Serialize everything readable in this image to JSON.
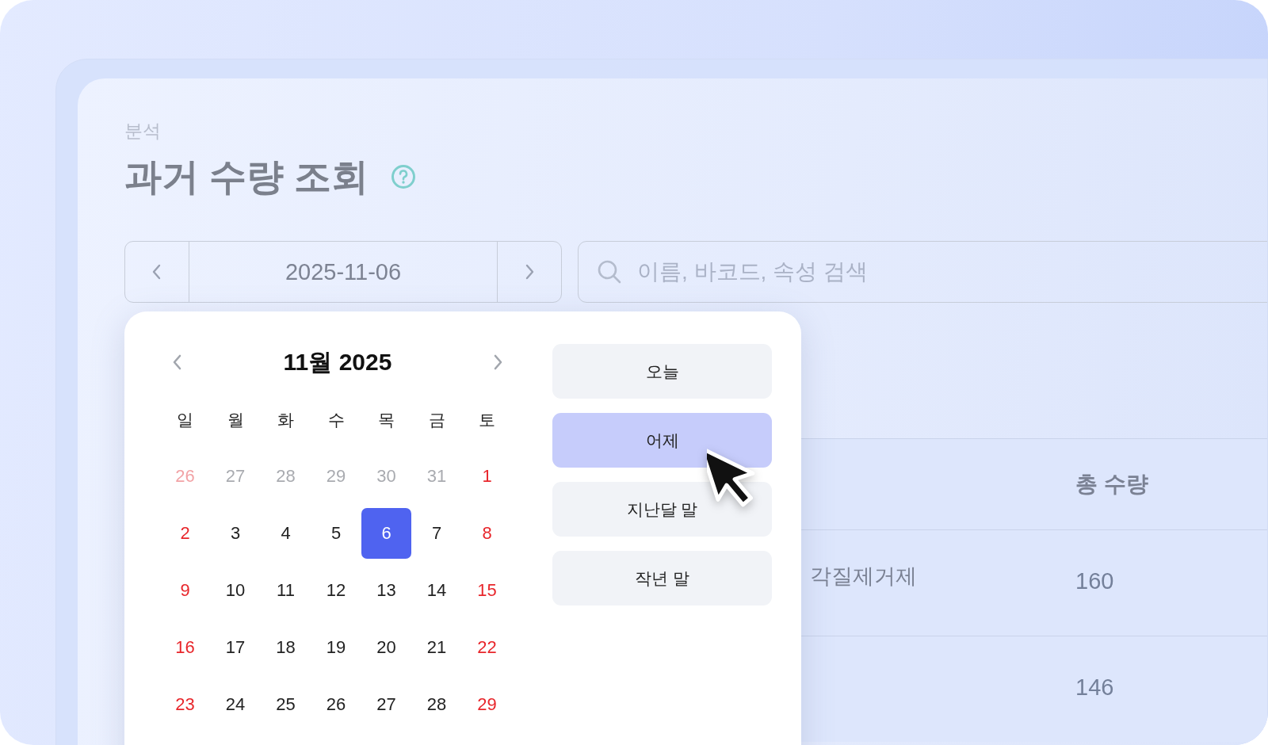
{
  "breadcrumb": "분석",
  "title": "과거 수량 조회",
  "date_nav": {
    "value": "2025-11-06"
  },
  "search": {
    "placeholder": "이름, 바코드, 속성 검색"
  },
  "calendar": {
    "month_title": "11월 2025",
    "weekdays": [
      "일",
      "월",
      "화",
      "수",
      "목",
      "금",
      "토"
    ],
    "days": [
      {
        "label": "26",
        "outside": true,
        "weekend": true,
        "selected": false
      },
      {
        "label": "27",
        "outside": true,
        "weekend": false,
        "selected": false
      },
      {
        "label": "28",
        "outside": true,
        "weekend": false,
        "selected": false
      },
      {
        "label": "29",
        "outside": true,
        "weekend": false,
        "selected": false
      },
      {
        "label": "30",
        "outside": true,
        "weekend": false,
        "selected": false
      },
      {
        "label": "31",
        "outside": true,
        "weekend": false,
        "selected": false
      },
      {
        "label": "1",
        "outside": false,
        "weekend": true,
        "selected": false
      },
      {
        "label": "2",
        "outside": false,
        "weekend": true,
        "selected": false
      },
      {
        "label": "3",
        "outside": false,
        "weekend": false,
        "selected": false
      },
      {
        "label": "4",
        "outside": false,
        "weekend": false,
        "selected": false
      },
      {
        "label": "5",
        "outside": false,
        "weekend": false,
        "selected": false
      },
      {
        "label": "6",
        "outside": false,
        "weekend": false,
        "selected": true
      },
      {
        "label": "7",
        "outside": false,
        "weekend": false,
        "selected": false
      },
      {
        "label": "8",
        "outside": false,
        "weekend": true,
        "selected": false
      },
      {
        "label": "9",
        "outside": false,
        "weekend": true,
        "selected": false
      },
      {
        "label": "10",
        "outside": false,
        "weekend": false,
        "selected": false
      },
      {
        "label": "11",
        "outside": false,
        "weekend": false,
        "selected": false
      },
      {
        "label": "12",
        "outside": false,
        "weekend": false,
        "selected": false
      },
      {
        "label": "13",
        "outside": false,
        "weekend": false,
        "selected": false
      },
      {
        "label": "14",
        "outside": false,
        "weekend": false,
        "selected": false
      },
      {
        "label": "15",
        "outside": false,
        "weekend": true,
        "selected": false
      },
      {
        "label": "16",
        "outside": false,
        "weekend": true,
        "selected": false
      },
      {
        "label": "17",
        "outside": false,
        "weekend": false,
        "selected": false
      },
      {
        "label": "18",
        "outside": false,
        "weekend": false,
        "selected": false
      },
      {
        "label": "19",
        "outside": false,
        "weekend": false,
        "selected": false
      },
      {
        "label": "20",
        "outside": false,
        "weekend": false,
        "selected": false
      },
      {
        "label": "21",
        "outside": false,
        "weekend": false,
        "selected": false
      },
      {
        "label": "22",
        "outside": false,
        "weekend": true,
        "selected": false
      },
      {
        "label": "23",
        "outside": false,
        "weekend": true,
        "selected": false
      },
      {
        "label": "24",
        "outside": false,
        "weekend": false,
        "selected": false
      },
      {
        "label": "25",
        "outside": false,
        "weekend": false,
        "selected": false
      },
      {
        "label": "26",
        "outside": false,
        "weekend": false,
        "selected": false
      },
      {
        "label": "27",
        "outside": false,
        "weekend": false,
        "selected": false
      },
      {
        "label": "28",
        "outside": false,
        "weekend": false,
        "selected": false
      },
      {
        "label": "29",
        "outside": false,
        "weekend": true,
        "selected": false
      }
    ]
  },
  "presets": [
    {
      "label": "오늘",
      "selected": false
    },
    {
      "label": "어제",
      "selected": true
    },
    {
      "label": "지난달 말",
      "selected": false
    },
    {
      "label": "작년 말",
      "selected": false
    }
  ],
  "table": {
    "header": {
      "column_2": "총 수량"
    },
    "rows": [
      {
        "column_1": "각질제거제",
        "column_2": "160"
      },
      {
        "column_2": "146"
      }
    ]
  }
}
